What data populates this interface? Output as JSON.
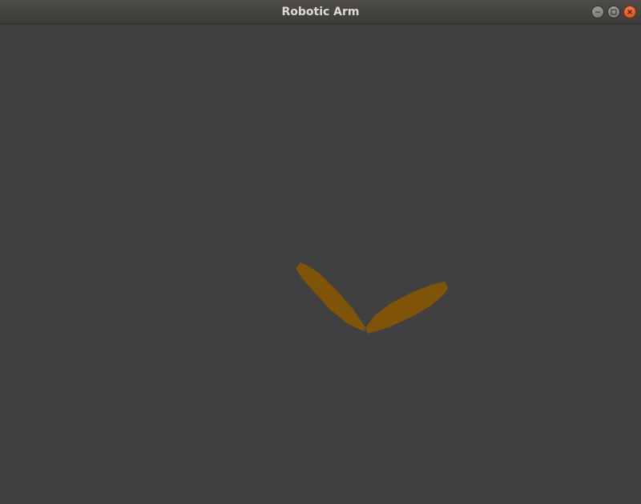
{
  "window": {
    "title": "Robotic Arm",
    "controls": [
      "minimize-icon",
      "maximize-icon",
      "close-icon"
    ]
  },
  "scene": {
    "background_color": "#404040",
    "arm_color": "#7f5409",
    "segment_count": 2
  }
}
